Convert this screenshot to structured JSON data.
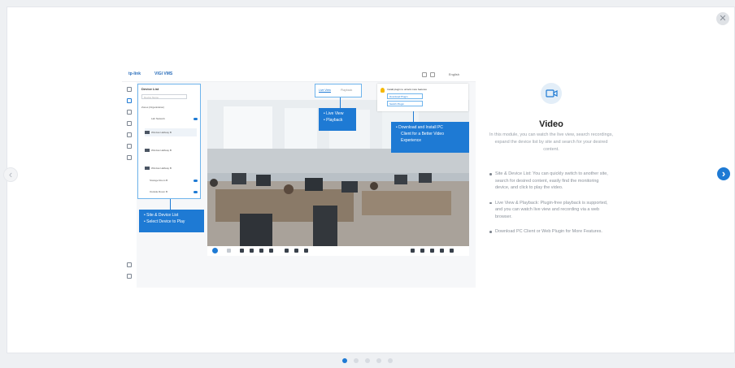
{
  "close_icon": "close-icon",
  "preview": {
    "brand": "tp-link",
    "product": "VIGI VMS",
    "language": "English",
    "device_list_title": "Device List",
    "search_placeholder": "Device Name",
    "tree": [
      "Zones (Organization)",
      "Lab Network",
      "Window Hallway B",
      "Window Hallway B",
      "Window Hallway B",
      "Storage Room B",
      "Outside Room B"
    ],
    "tabs": {
      "live": "Live View",
      "playback": "Playback"
    },
    "plugin_msg": "Install plugin to unlock more features",
    "plugin_b1": "Download Plugin",
    "plugin_b2": "Switch Plugin"
  },
  "callouts": {
    "live_view": [
      "• Live View",
      "• Playback"
    ],
    "download": [
      "• Download and Install PC",
      "Client for a Better Video",
      "Experience"
    ],
    "site": [
      "• Site & Device List",
      "• Select Device to Play"
    ]
  },
  "info": {
    "icon": "video-camera-icon",
    "title": "Video",
    "description": "In this module, you can watch the live view, search recordings, expand the device list by site and search for your desired content.",
    "bullets": [
      "Site & Device List: You can quickly switch to another site, search for desired content, easily find the monitoring device, and click to play the video.",
      "Live View & Playback: Plugin-free playback is supported, and you can watch live view and recording via a web browser.",
      "Download PC Client or Web Plugin for More Features."
    ]
  },
  "pager": {
    "count": 5,
    "active": 0
  },
  "colors": {
    "accent": "#1e7ad4",
    "callout": "#1e7ad4",
    "icon_bg": "#e3eef8"
  }
}
